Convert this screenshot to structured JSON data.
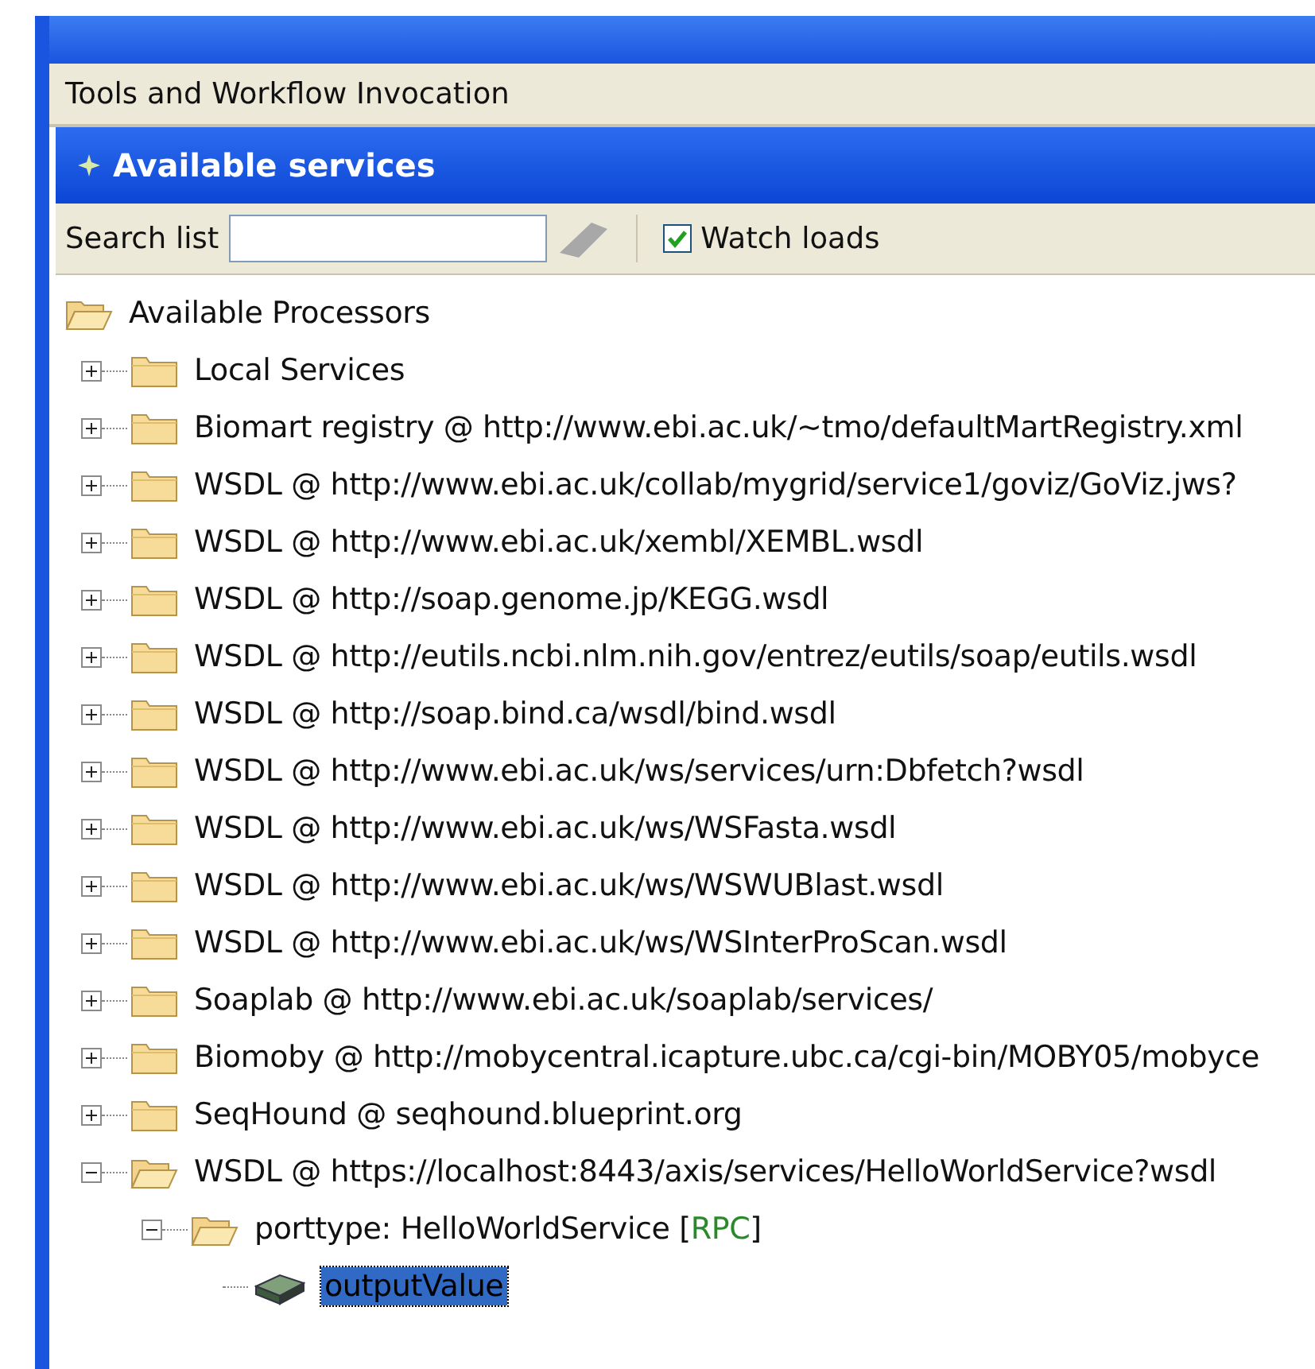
{
  "menu_bar": {
    "title": "Tools and Workflow Invocation"
  },
  "panel": {
    "title": "Available services"
  },
  "toolbar": {
    "search_label": "Search list",
    "watch_loads": {
      "label": "Watch loads",
      "checked": true
    }
  },
  "tree": [
    {
      "kind": "folder",
      "label": "Available Processors",
      "expanded": true,
      "selected": false,
      "children": [
        {
          "kind": "folder",
          "label": "Local Services",
          "expanded": false,
          "selected": false
        },
        {
          "kind": "folder",
          "label": "Biomart registry @ http://www.ebi.ac.uk/~tmo/defaultMartRegistry.xml",
          "expanded": false,
          "selected": false
        },
        {
          "kind": "folder",
          "label": "WSDL @ http://www.ebi.ac.uk/collab/mygrid/service1/goviz/GoViz.jws?",
          "expanded": false,
          "selected": false
        },
        {
          "kind": "folder",
          "label": "WSDL @ http://www.ebi.ac.uk/xembl/XEMBL.wsdl",
          "expanded": false,
          "selected": false
        },
        {
          "kind": "folder",
          "label": "WSDL @ http://soap.genome.jp/KEGG.wsdl",
          "expanded": false,
          "selected": false
        },
        {
          "kind": "folder",
          "label": "WSDL @ http://eutils.ncbi.nlm.nih.gov/entrez/eutils/soap/eutils.wsdl",
          "expanded": false,
          "selected": false
        },
        {
          "kind": "folder",
          "label": "WSDL @ http://soap.bind.ca/wsdl/bind.wsdl",
          "expanded": false,
          "selected": false
        },
        {
          "kind": "folder",
          "label": "WSDL @ http://www.ebi.ac.uk/ws/services/urn:Dbfetch?wsdl",
          "expanded": false,
          "selected": false
        },
        {
          "kind": "folder",
          "label": "WSDL @ http://www.ebi.ac.uk/ws/WSFasta.wsdl",
          "expanded": false,
          "selected": false
        },
        {
          "kind": "folder",
          "label": "WSDL @ http://www.ebi.ac.uk/ws/WSWUBlast.wsdl",
          "expanded": false,
          "selected": false
        },
        {
          "kind": "folder",
          "label": "WSDL @ http://www.ebi.ac.uk/ws/WSInterProScan.wsdl",
          "expanded": false,
          "selected": false
        },
        {
          "kind": "folder",
          "label": "Soaplab @ http://www.ebi.ac.uk/soaplab/services/",
          "expanded": false,
          "selected": false
        },
        {
          "kind": "folder",
          "label": "Biomoby @ http://mobycentral.icapture.ubc.ca/cgi-bin/MOBY05/mobyce",
          "expanded": false,
          "selected": false
        },
        {
          "kind": "folder",
          "label": "SeqHound @ seqhound.blueprint.org",
          "expanded": false,
          "selected": false
        },
        {
          "kind": "folder",
          "label": "WSDL @ https://localhost:8443/axis/services/HelloWorldService?wsdl",
          "expanded": true,
          "selected": false,
          "children": [
            {
              "kind": "folder",
              "label_parts": [
                {
                  "kind": "plain",
                  "text": "porttype: HelloWorldService ["
                },
                {
                  "kind": "tag",
                  "text": "RPC"
                },
                {
                  "kind": "plain",
                  "text": "]"
                }
              ],
              "expanded": true,
              "selected": false,
              "children": [
                {
                  "kind": "operation",
                  "label": "outputValue",
                  "selected": true
                }
              ]
            }
          ]
        }
      ]
    }
  ]
}
